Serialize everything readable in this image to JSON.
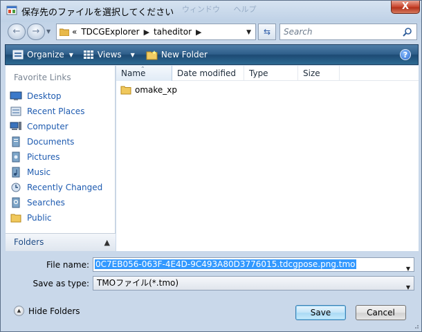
{
  "window": {
    "title": "保存先のファイルを選択してください",
    "ghost_menu": [
      "ウィンドウ",
      "ヘルプ"
    ],
    "close_label": "X"
  },
  "address": {
    "overflow": "«",
    "crumbs": [
      "TDCGExplorer",
      "taheditor"
    ]
  },
  "search": {
    "placeholder": "Search"
  },
  "toolbar": {
    "organize": "Organize",
    "views": "Views",
    "new_folder": "New Folder",
    "help": "?"
  },
  "left_pane": {
    "heading": "Favorite Links",
    "items": [
      {
        "label": "Desktop",
        "icon": "desktop-icon"
      },
      {
        "label": "Recent Places",
        "icon": "recent-places-icon"
      },
      {
        "label": "Computer",
        "icon": "computer-icon"
      },
      {
        "label": "Documents",
        "icon": "documents-icon"
      },
      {
        "label": "Pictures",
        "icon": "pictures-icon"
      },
      {
        "label": "Music",
        "icon": "music-icon"
      },
      {
        "label": "Recently Changed",
        "icon": "recently-changed-icon"
      },
      {
        "label": "Searches",
        "icon": "searches-icon"
      },
      {
        "label": "Public",
        "icon": "public-icon"
      }
    ],
    "folders_label": "Folders"
  },
  "file_list": {
    "columns": [
      "Name",
      "Date modified",
      "Type",
      "Size"
    ],
    "rows": [
      {
        "name": "omake_xp",
        "icon": "folder-icon"
      }
    ]
  },
  "form": {
    "file_name_label": "File name:",
    "file_name_value": "0C7EB056-063F-4E4D-9C493A80D3776015.tdcgpose.png.tmo",
    "save_as_type_label": "Save as type:",
    "save_as_type_value": "TMOファイル(*.tmo)"
  },
  "footer": {
    "hide_folders": "Hide Folders",
    "save": "Save",
    "cancel": "Cancel"
  },
  "colors": {
    "toolbar": "#2e5e8a",
    "link": "#1e5bb0",
    "selection": "#3399ff"
  }
}
